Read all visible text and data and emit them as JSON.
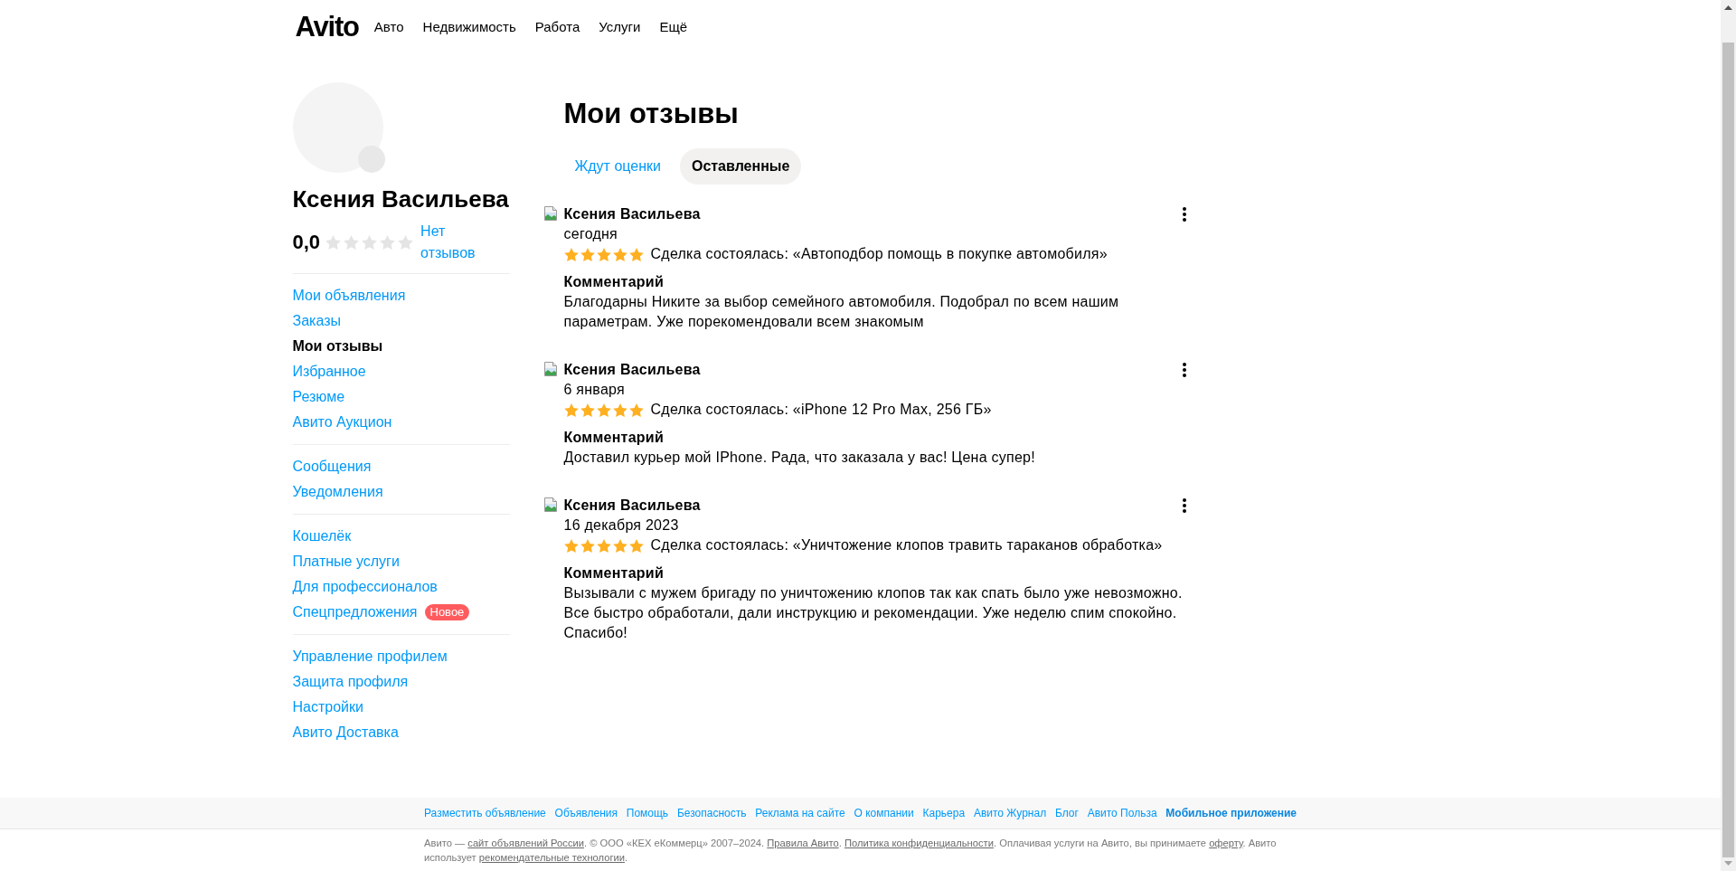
{
  "header": {
    "logo": "Avito",
    "nav": [
      "Авто",
      "Недвижимость",
      "Работа",
      "Услуги",
      "Ещё"
    ]
  },
  "profile": {
    "name": "Ксения Васильева",
    "rating": "0,0",
    "stars": 0,
    "reviews_link": "Нет отзывов"
  },
  "sidebar": {
    "groups": [
      {
        "items": [
          {
            "label": "Мои объявления",
            "selected": false
          },
          {
            "label": "Заказы",
            "selected": false
          },
          {
            "label": "Мои отзывы",
            "selected": true
          },
          {
            "label": "Избранное",
            "selected": false
          },
          {
            "label": "Резюме",
            "selected": false
          },
          {
            "label": "Авито Аукцион",
            "selected": false
          }
        ]
      },
      {
        "items": [
          {
            "label": "Сообщения",
            "selected": false
          },
          {
            "label": "Уведомления",
            "selected": false
          }
        ]
      },
      {
        "items": [
          {
            "label": "Кошелёк",
            "selected": false
          },
          {
            "label": "Платные услуги",
            "selected": false
          },
          {
            "label": "Для профессионалов",
            "selected": false
          },
          {
            "label": "Спецпредложения",
            "selected": false,
            "badge": "Новое"
          }
        ]
      },
      {
        "items": [
          {
            "label": "Управление профилем",
            "selected": false
          },
          {
            "label": "Защита профиля",
            "selected": false
          },
          {
            "label": "Настройки",
            "selected": false
          },
          {
            "label": "Авито Доставка",
            "selected": false
          }
        ]
      }
    ]
  },
  "page_title": "Мои отзывы",
  "tabs": [
    {
      "label": "Ждут оценки",
      "selected": false
    },
    {
      "label": "Оставленные",
      "selected": true
    }
  ],
  "reviews": [
    {
      "author": "Ксения Васильева",
      "date": "сегодня",
      "stars": 5,
      "deal": "Сделка состоялась: «Автоподбор помощь в покупке автомобиля»",
      "comment_heading": "Комментарий",
      "comment": "Благодарны Никите за выбор семейного автомобиля. Подобрал по всем нашим параметрам. Уже порекомендовали всем знакомым"
    },
    {
      "author": "Ксения Васильева",
      "date": "6 января",
      "stars": 5,
      "deal": "Сделка состоялась: «iPhone 12 Pro Max, 256 ГБ»",
      "comment_heading": "Комментарий",
      "comment": "Доставил курьер мой IPhone. Рада, что заказала у вас! Цена супер!"
    },
    {
      "author": "Ксения Васильева",
      "date": "16 декабря 2023",
      "stars": 5,
      "deal": "Сделка состоялась: «Уничтожение клопов травить тараканов обработка»",
      "comment_heading": "Комментарий",
      "comment": "Вызывали с мужем бригаду по уничтожению клопов так как спать было уже невозможно. Все быстро обработали, дали инструкцию и рекомендации. Уже неделю спим спокойно. Спасибо!"
    }
  ],
  "footer": {
    "links": [
      {
        "label": "Разместить объявление",
        "bold": false
      },
      {
        "label": "Объявления",
        "bold": false
      },
      {
        "label": "Помощь",
        "bold": false
      },
      {
        "label": "Безопасность",
        "bold": false
      },
      {
        "label": "Реклама на сайте",
        "bold": false
      },
      {
        "label": "О компании",
        "bold": false
      },
      {
        "label": "Карьера",
        "bold": false
      },
      {
        "label": "Авито Журнал",
        "bold": false
      },
      {
        "label": "Блог",
        "bold": false
      },
      {
        "label": "Авито Польза",
        "bold": false
      },
      {
        "label": "Мобильное приложение",
        "bold": true
      }
    ],
    "copyright": [
      {
        "kind": "text",
        "text": "Авито — "
      },
      {
        "kind": "link",
        "text": "сайт объявлений России"
      },
      {
        "kind": "text",
        "text": ". © ООО «КЕХ еКоммерц» 2007–2024. "
      },
      {
        "kind": "link",
        "text": "Правила Авито"
      },
      {
        "kind": "text",
        "text": ". "
      },
      {
        "kind": "link",
        "text": "Политика конфиденциальности"
      },
      {
        "kind": "text",
        "text": ". Оплачивая услуги на Авито, вы принимаете "
      },
      {
        "kind": "link",
        "text": "оферту"
      },
      {
        "kind": "text",
        "text": ". Авито использует "
      },
      {
        "kind": "link",
        "text": "рекомендательные технологии"
      },
      {
        "kind": "text",
        "text": "."
      }
    ]
  }
}
